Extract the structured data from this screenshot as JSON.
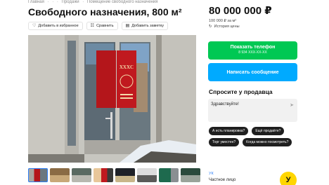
{
  "breadcrumb": [
    "Главная",
    "·",
    "·",
    "·",
    "Продажи",
    "·",
    "Помещение свободного назначения"
  ],
  "title": "Свободного назначения, 800 м²",
  "actions": {
    "favorite": "Добавить в избранное",
    "compare": "Сравнить",
    "note": "Добавить заметку"
  },
  "price": {
    "total": "80 000 000 ₽",
    "per_meter": "100 000 ₽ за м²",
    "history": "История цены"
  },
  "contact": {
    "phone_label": "Показать телефон",
    "phone_number": "8 934 XXX-XX-XX",
    "message_label": "Написать сообщение"
  },
  "ask": {
    "title": "Спросите у продавца",
    "message": "Здравствуйте!",
    "quick_questions": [
      "А есть планировка?",
      "Ещё продаёте?",
      "Торг уместен?",
      "Когда можно посмотреть?"
    ]
  },
  "seller": {
    "label": "УК",
    "type": "Частное лицо",
    "avatar_letter": "У"
  },
  "photo": {
    "poster_text": "XXXC"
  },
  "colors": {
    "primary_green": "#00c853",
    "primary_blue": "#00aaff",
    "chip_dark": "#1f1f1f",
    "avatar_yellow": "#ffd600",
    "link_blue": "#2d7ff9"
  }
}
